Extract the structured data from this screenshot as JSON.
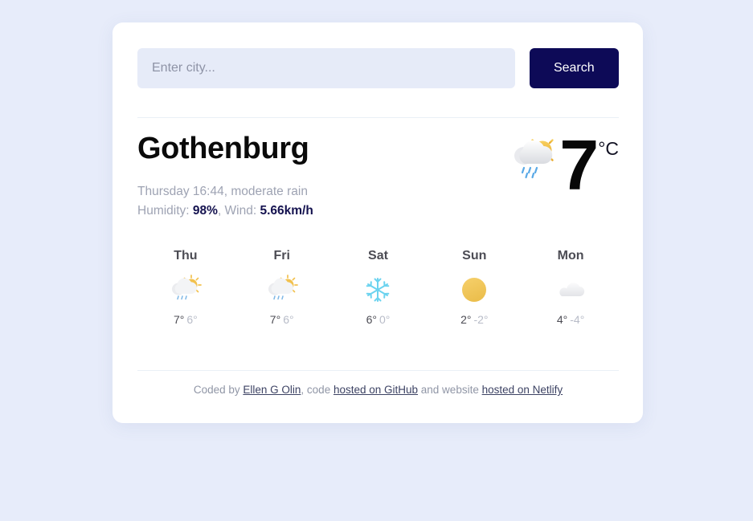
{
  "search": {
    "placeholder": "Enter city...",
    "value": "",
    "button_label": "Search"
  },
  "current": {
    "city": "Gothenburg",
    "datetime_description": "Thursday 16:44, moderate rain",
    "humidity_label": "Humidity: ",
    "humidity_value": "98%",
    "wind_separator": ", Wind: ",
    "wind_value": "5.66km/h",
    "temperature": "7",
    "unit": "°C",
    "icon": "sun-behind-rain-cloud-icon"
  },
  "forecast": [
    {
      "day": "Thu",
      "icon": "sun-behind-rain-cloud-icon",
      "temp_max": "7°",
      "temp_min": "6°"
    },
    {
      "day": "Fri",
      "icon": "sun-behind-rain-cloud-icon",
      "temp_max": "7°",
      "temp_min": "6°"
    },
    {
      "day": "Sat",
      "icon": "snowflake-icon",
      "temp_max": "6°",
      "temp_min": "0°"
    },
    {
      "day": "Sun",
      "icon": "sun-icon",
      "temp_max": "2°",
      "temp_min": "-2°"
    },
    {
      "day": "Mon",
      "icon": "cloud-icon",
      "temp_max": "4°",
      "temp_min": "-4°"
    }
  ],
  "footer": {
    "prefix": "Coded by ",
    "author_link": "Ellen G Olin",
    "middle": ", code ",
    "github_link": "hosted on GitHub",
    "between": " and website ",
    "netlify_link": "hosted on Netlify"
  },
  "colors": {
    "page_background": "#e7ecfa",
    "card_background": "#ffffff",
    "accent_navy": "#0d0a57",
    "input_background": "#e6ebf8",
    "muted_text": "#9ea3b3",
    "sun_yellow": "#f2c14e",
    "snow_blue": "#6cd3ef",
    "rain_blue": "#5aa9e6"
  }
}
